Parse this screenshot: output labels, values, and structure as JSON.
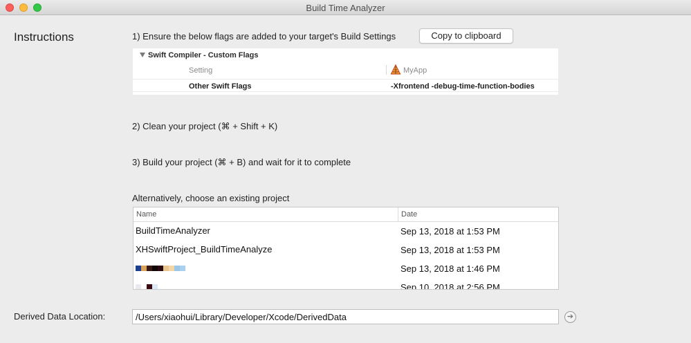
{
  "window": {
    "title": "Build Time Analyzer"
  },
  "instructions": {
    "heading": "Instructions",
    "step1": "1) Ensure the below flags are added to your target's Build Settings",
    "copy_button": "Copy to clipboard",
    "step2": "2) Clean your project (⌘ + Shift + K)",
    "step3": "3) Build your project (⌘ + B) and wait for it to complete",
    "alternative": "Alternatively, choose an existing project"
  },
  "flags_panel": {
    "section_title": "Swift Compiler - Custom Flags",
    "column_setting": "Setting",
    "column_target": "MyApp",
    "target_icon": "xcode-app-icon",
    "row_name": "Other Swift Flags",
    "row_value": "-Xfrontend -debug-time-function-bodies"
  },
  "projects_table": {
    "columns": {
      "name": "Name",
      "date": "Date"
    },
    "rows": [
      {
        "name": "BuildTimeAnalyzer",
        "date": "Sep 13, 2018 at 1:53 PM"
      },
      {
        "name": "XHSwiftProject_BuildTimeAnalyze",
        "date": "Sep 13, 2018 at 1:53 PM"
      },
      {
        "name": "",
        "date": "Sep 13, 2018 at 1:46 PM",
        "redacted_colors": [
          "#1c3f8f",
          "#d9a35b",
          "#3a1a14",
          "#110608",
          "#2b0a0f",
          "#e8c58e",
          "#f2d6a8",
          "#9cc6e6",
          "#a9d0ee"
        ]
      },
      {
        "name": "",
        "date": "Sep 10, 2018 at 2:56 PM",
        "redacted_colors": [
          "#e9e9ef",
          "#ffffff",
          "#3a0a12",
          "#dde9f5"
        ]
      }
    ]
  },
  "derived_data": {
    "label": "Derived Data Location:",
    "path": "/Users/xiaohui/Library/Developer/Xcode/DerivedData",
    "go_icon": "arrow-right-circle-icon"
  }
}
